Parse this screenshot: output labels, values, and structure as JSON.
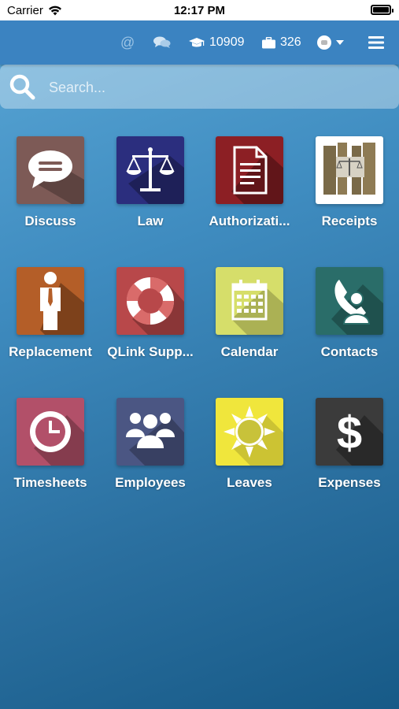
{
  "status_bar": {
    "carrier": "Carrier",
    "time": "12:17 PM"
  },
  "navbar": {
    "mentions_icon": "at-icon",
    "chat_icon": "chat-icon",
    "education_count": "10909",
    "briefcase_count": "326",
    "user_icon": "avatar",
    "menu_icon": "hamburger-menu-icon"
  },
  "search": {
    "placeholder": "Search..."
  },
  "apps": [
    {
      "label": "Discuss",
      "icon": "chat-bubble-icon",
      "color": "#7d5a56"
    },
    {
      "label": "Law",
      "icon": "scales-icon",
      "color": "#2b2e7e"
    },
    {
      "label": "Authorizati...",
      "icon": "document-icon",
      "color": "#8c1f24"
    },
    {
      "label": "Receipts",
      "icon": "books-scales-icon",
      "color": "#ffffff"
    },
    {
      "label": "Replacement",
      "icon": "person-tie-icon",
      "color": "#b45e28"
    },
    {
      "label": "QLink Supp...",
      "icon": "lifebuoy-icon",
      "color": "#b8484a"
    },
    {
      "label": "Calendar",
      "icon": "calendar-icon",
      "color": "#d6de6a"
    },
    {
      "label": "Contacts",
      "icon": "contact-phone-icon",
      "color": "#2a6d69"
    },
    {
      "label": "Timesheets",
      "icon": "clock-icon",
      "color": "#b25069"
    },
    {
      "label": "Employees",
      "icon": "group-icon",
      "color": "#4b5683"
    },
    {
      "label": "Leaves",
      "icon": "sun-icon",
      "color": "#f0e63c"
    },
    {
      "label": "Expenses",
      "icon": "dollar-icon",
      "color": "#3b3b3b"
    }
  ]
}
